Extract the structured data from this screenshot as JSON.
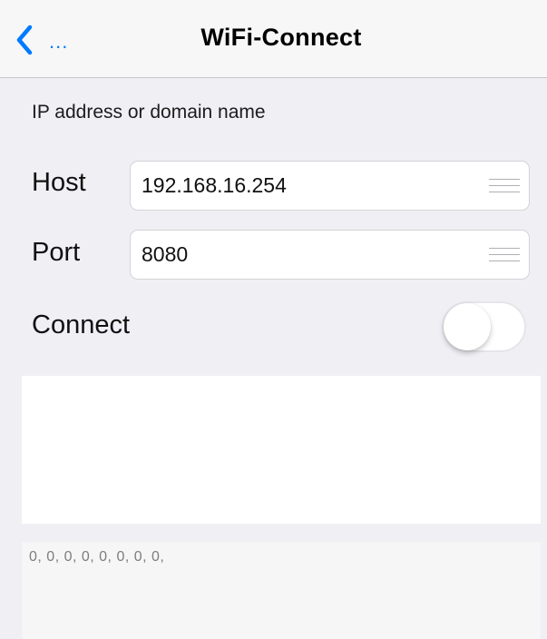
{
  "navbar": {
    "back_label": "...",
    "title": "WiFi-Connect",
    "back_icon": "chevron-left-icon"
  },
  "form": {
    "hint": "IP address or domain name",
    "host": {
      "label": "Host",
      "value": "192.168.16.254"
    },
    "port": {
      "label": "Port",
      "value": "8080"
    },
    "connect": {
      "label": "Connect",
      "on": false
    }
  },
  "log": {
    "text": "0, 0, 0, 0, 0, 0, 0, 0,"
  },
  "colors": {
    "accent": "#007aff",
    "background": "#efeff4"
  }
}
